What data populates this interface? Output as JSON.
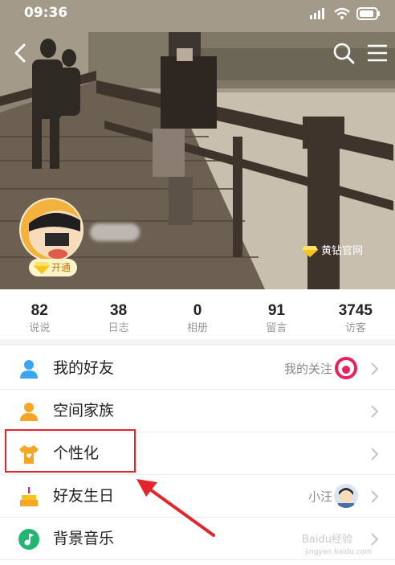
{
  "status_bar": {
    "time": "09:36"
  },
  "profile": {
    "vip_label": "开通",
    "yellow_diamond_link": "黄钻官网"
  },
  "stats": [
    {
      "value": "82",
      "label": "说说"
    },
    {
      "value": "38",
      "label": "日志"
    },
    {
      "value": "0",
      "label": "相册"
    },
    {
      "value": "91",
      "label": "留言"
    },
    {
      "value": "3745",
      "label": "访客"
    }
  ],
  "menu": {
    "friends": {
      "label": "我的好友",
      "right_text": "我的关注"
    },
    "family": {
      "label": "空间家族"
    },
    "personalize": {
      "label": "个性化"
    },
    "birthday": {
      "label": "好友生日",
      "right_text": "小汪"
    },
    "music": {
      "label": "背景音乐"
    }
  },
  "watermark": {
    "text": "Baidu经验",
    "sub": "jingyan.baidu.com"
  },
  "colors": {
    "annotation_red": "#e2262c",
    "icon_blue": "#3aa6f0",
    "icon_orange": "#f5a623",
    "icon_green": "#22b573"
  }
}
